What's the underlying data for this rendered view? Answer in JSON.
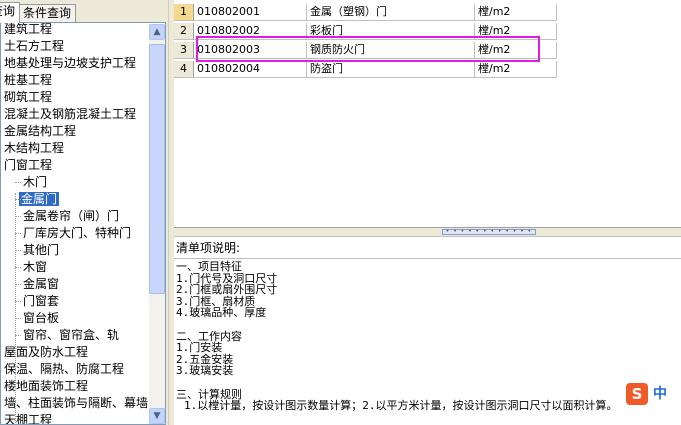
{
  "tabs": {
    "query": "查询",
    "conditions": "条件查询"
  },
  "tree": {
    "items": [
      {
        "label": "建筑工程",
        "level": 0
      },
      {
        "label": "土石方工程",
        "level": 0
      },
      {
        "label": "地基处理与边坡支护工程",
        "level": 0
      },
      {
        "label": "桩基工程",
        "level": 0
      },
      {
        "label": "砌筑工程",
        "level": 0
      },
      {
        "label": "混凝土及钢筋混凝土工程",
        "level": 0
      },
      {
        "label": "金属结构工程",
        "level": 0
      },
      {
        "label": "木结构工程",
        "level": 0
      },
      {
        "label": "门窗工程",
        "level": 0
      },
      {
        "label": "木门",
        "level": 1
      },
      {
        "label": "金属门",
        "level": 1,
        "selected": true
      },
      {
        "label": "金属卷帘（闸）门",
        "level": 1
      },
      {
        "label": "厂库房大门、特种门",
        "level": 1
      },
      {
        "label": "其他门",
        "level": 1
      },
      {
        "label": "木窗",
        "level": 1
      },
      {
        "label": "金属窗",
        "level": 1
      },
      {
        "label": "门窗套",
        "level": 1
      },
      {
        "label": "窗台板",
        "level": 1
      },
      {
        "label": "窗帘、窗帘盒、轨",
        "level": 1
      },
      {
        "label": "屋面及防水工程",
        "level": 0
      },
      {
        "label": "保温、隔热、防腐工程",
        "level": 0
      },
      {
        "label": "楼地面装饰工程",
        "level": 0
      },
      {
        "label": "墙、柱面装饰与隔断、幕墙",
        "level": 0
      },
      {
        "label": "天棚工程",
        "level": 0
      }
    ]
  },
  "scroll": {
    "up": "▲",
    "down": "▼"
  },
  "grid": {
    "rows": [
      {
        "num": "1",
        "code": "010802001",
        "name": "金属（塑钢）门",
        "unit": "樘/m2"
      },
      {
        "num": "2",
        "code": "010802002",
        "name": "彩板门",
        "unit": "樘/m2"
      },
      {
        "num": "3",
        "code": "010802003",
        "name": "钢质防火门",
        "unit": "樘/m2"
      },
      {
        "num": "4",
        "code": "010802004",
        "name": "防盗门",
        "unit": "樘/m2"
      }
    ]
  },
  "splitter_grip": "• • • • • • • • • • • •",
  "description": {
    "header": "清单项说明:",
    "lines": [
      "一、项目特征",
      "1.门代号及洞口尺寸",
      "2.门框或扇外围尺寸",
      "3.门框、扇材质",
      "4.玻璃品种、厚度",
      "",
      "二、工作内容",
      "1.门安装",
      "2.五金安装",
      "3.玻璃安装",
      "",
      "三、计算规则",
      "1.以樘计量，按设计图示数量计算；2.以平方米计量，按设计图示洞口尺寸以面积计算。"
    ]
  },
  "ime": {
    "logo": "S",
    "lang": "中"
  },
  "colors": {
    "highlight": "#e31ae3",
    "selection": "#316ac5",
    "current_row": "#f5d98f"
  }
}
